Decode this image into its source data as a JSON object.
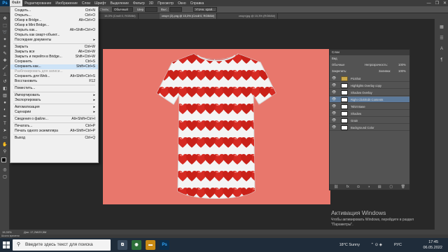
{
  "app": {
    "logo": "Ps"
  },
  "menubar": {
    "items": [
      "Файл",
      "Редактирование",
      "Изображение",
      "Слои",
      "Шрифт",
      "Выделение",
      "Фильтр",
      "3D",
      "Просмотр",
      "Окно",
      "Справка"
    ],
    "window_controls": [
      "—",
      "❐",
      "✕"
    ]
  },
  "optionsbar": {
    "style_label": "Стиль:",
    "style_value": "Обычный",
    "width_label": "Шир.:",
    "height_label": "Выс.:",
    "refine_button": "Уточн. край..."
  },
  "tabs": [
    "15,3% (Слой 0, RGB/8#)",
    "спорт (2).png @ 15,3% (Слой 0, RGB/8#)",
    "спорт.jpg @ 15,3% (RGB/8#)"
  ],
  "file_menu": {
    "items": [
      {
        "label": "Создать...",
        "shortcut": "Ctrl+N",
        "enabled": true
      },
      {
        "label": "Открыть...",
        "shortcut": "Ctrl+O",
        "enabled": true
      },
      {
        "label": "Обзор в Bridge...",
        "shortcut": "Alt+Ctrl+O",
        "enabled": true
      },
      {
        "label": "Обзор в Mini Bridge...",
        "shortcut": "",
        "enabled": true
      },
      {
        "label": "Открыть как...",
        "shortcut": "Alt+Shift+Ctrl+O",
        "enabled": true
      },
      {
        "label": "Открыть как смарт-объект...",
        "shortcut": "",
        "enabled": true
      },
      {
        "label": "Последние документы",
        "shortcut": "",
        "enabled": true,
        "submenu": true
      },
      {
        "sep": true
      },
      {
        "label": "Закрыть",
        "shortcut": "Ctrl+W",
        "enabled": true
      },
      {
        "label": "Закрыть все",
        "shortcut": "Alt+Ctrl+W",
        "enabled": true
      },
      {
        "label": "Закрыть и перейти в Bridge...",
        "shortcut": "Shift+Ctrl+W",
        "enabled": true
      },
      {
        "label": "Сохранить",
        "shortcut": "Ctrl+S",
        "enabled": true
      },
      {
        "label": "Сохранить как...",
        "shortcut": "Shift+Ctrl+S",
        "enabled": true,
        "highlight": true
      },
      {
        "label": "Разблокировать для записи...",
        "shortcut": "",
        "enabled": false
      },
      {
        "label": "Сохранить для Web...",
        "shortcut": "Alt+Shift+Ctrl+S",
        "enabled": true
      },
      {
        "label": "Восстановить",
        "shortcut": "F12",
        "enabled": true
      },
      {
        "sep": true
      },
      {
        "label": "Поместить...",
        "shortcut": "",
        "enabled": true
      },
      {
        "sep": true
      },
      {
        "label": "Импортировать",
        "shortcut": "",
        "enabled": true,
        "submenu": true
      },
      {
        "label": "Экспортировать",
        "shortcut": "",
        "enabled": true,
        "submenu": true
      },
      {
        "sep": true
      },
      {
        "label": "Автоматизация",
        "shortcut": "",
        "enabled": true,
        "submenu": true
      },
      {
        "label": "Сценарии",
        "shortcut": "",
        "enabled": true,
        "submenu": true
      },
      {
        "sep": true
      },
      {
        "label": "Сведения о файле...",
        "shortcut": "Alt+Shift+Ctrl+I",
        "enabled": true
      },
      {
        "sep": true
      },
      {
        "label": "Печатать...",
        "shortcut": "Ctrl+P",
        "enabled": true
      },
      {
        "label": "Печать одного экземпляра",
        "shortcut": "Alt+Shift+Ctrl+P",
        "enabled": true
      },
      {
        "sep": true
      },
      {
        "label": "Выход",
        "shortcut": "Ctrl+Q",
        "enabled": true
      }
    ]
  },
  "layers_panel": {
    "title": "Слои",
    "filter_label": "Вид",
    "blend_mode": "Обычные",
    "opacity_label": "Непрозрачность:",
    "opacity_value": "100%",
    "lock_label": "Закрепить:",
    "fill_label": "Заливка:",
    "fill_value": "100%",
    "layers": [
      {
        "name": "PicShot",
        "group": true
      },
      {
        "name": "Highlights Overlay copy"
      },
      {
        "name": "Shadow Overlay"
      },
      {
        "name": "Right Click/Edit Contents",
        "selected": true
      },
      {
        "name": "Tshirt Base"
      },
      {
        "name": "Shadow"
      },
      {
        "name": "Grain"
      },
      {
        "name": "Background Color"
      }
    ]
  },
  "statusbar": {
    "zoom": "15,33%",
    "doc_info": "Док: 17,2M/29,5M"
  },
  "timeline_label": "Шкала времени",
  "watermark": {
    "title": "Активация Windows",
    "body": "Чтобы активировать Windows, перейдите в раздел \"Параметры\"."
  },
  "taskbar": {
    "search_placeholder": "Введите здесь текст для поиска",
    "weather": "18°C  Sunny",
    "language": "РУС",
    "time": "17:45",
    "date": "06.05.2022"
  },
  "colors": {
    "canvas_bg": "#e8776c",
    "ps_blue": "#31a8ff",
    "panel_bg": "#535353"
  }
}
